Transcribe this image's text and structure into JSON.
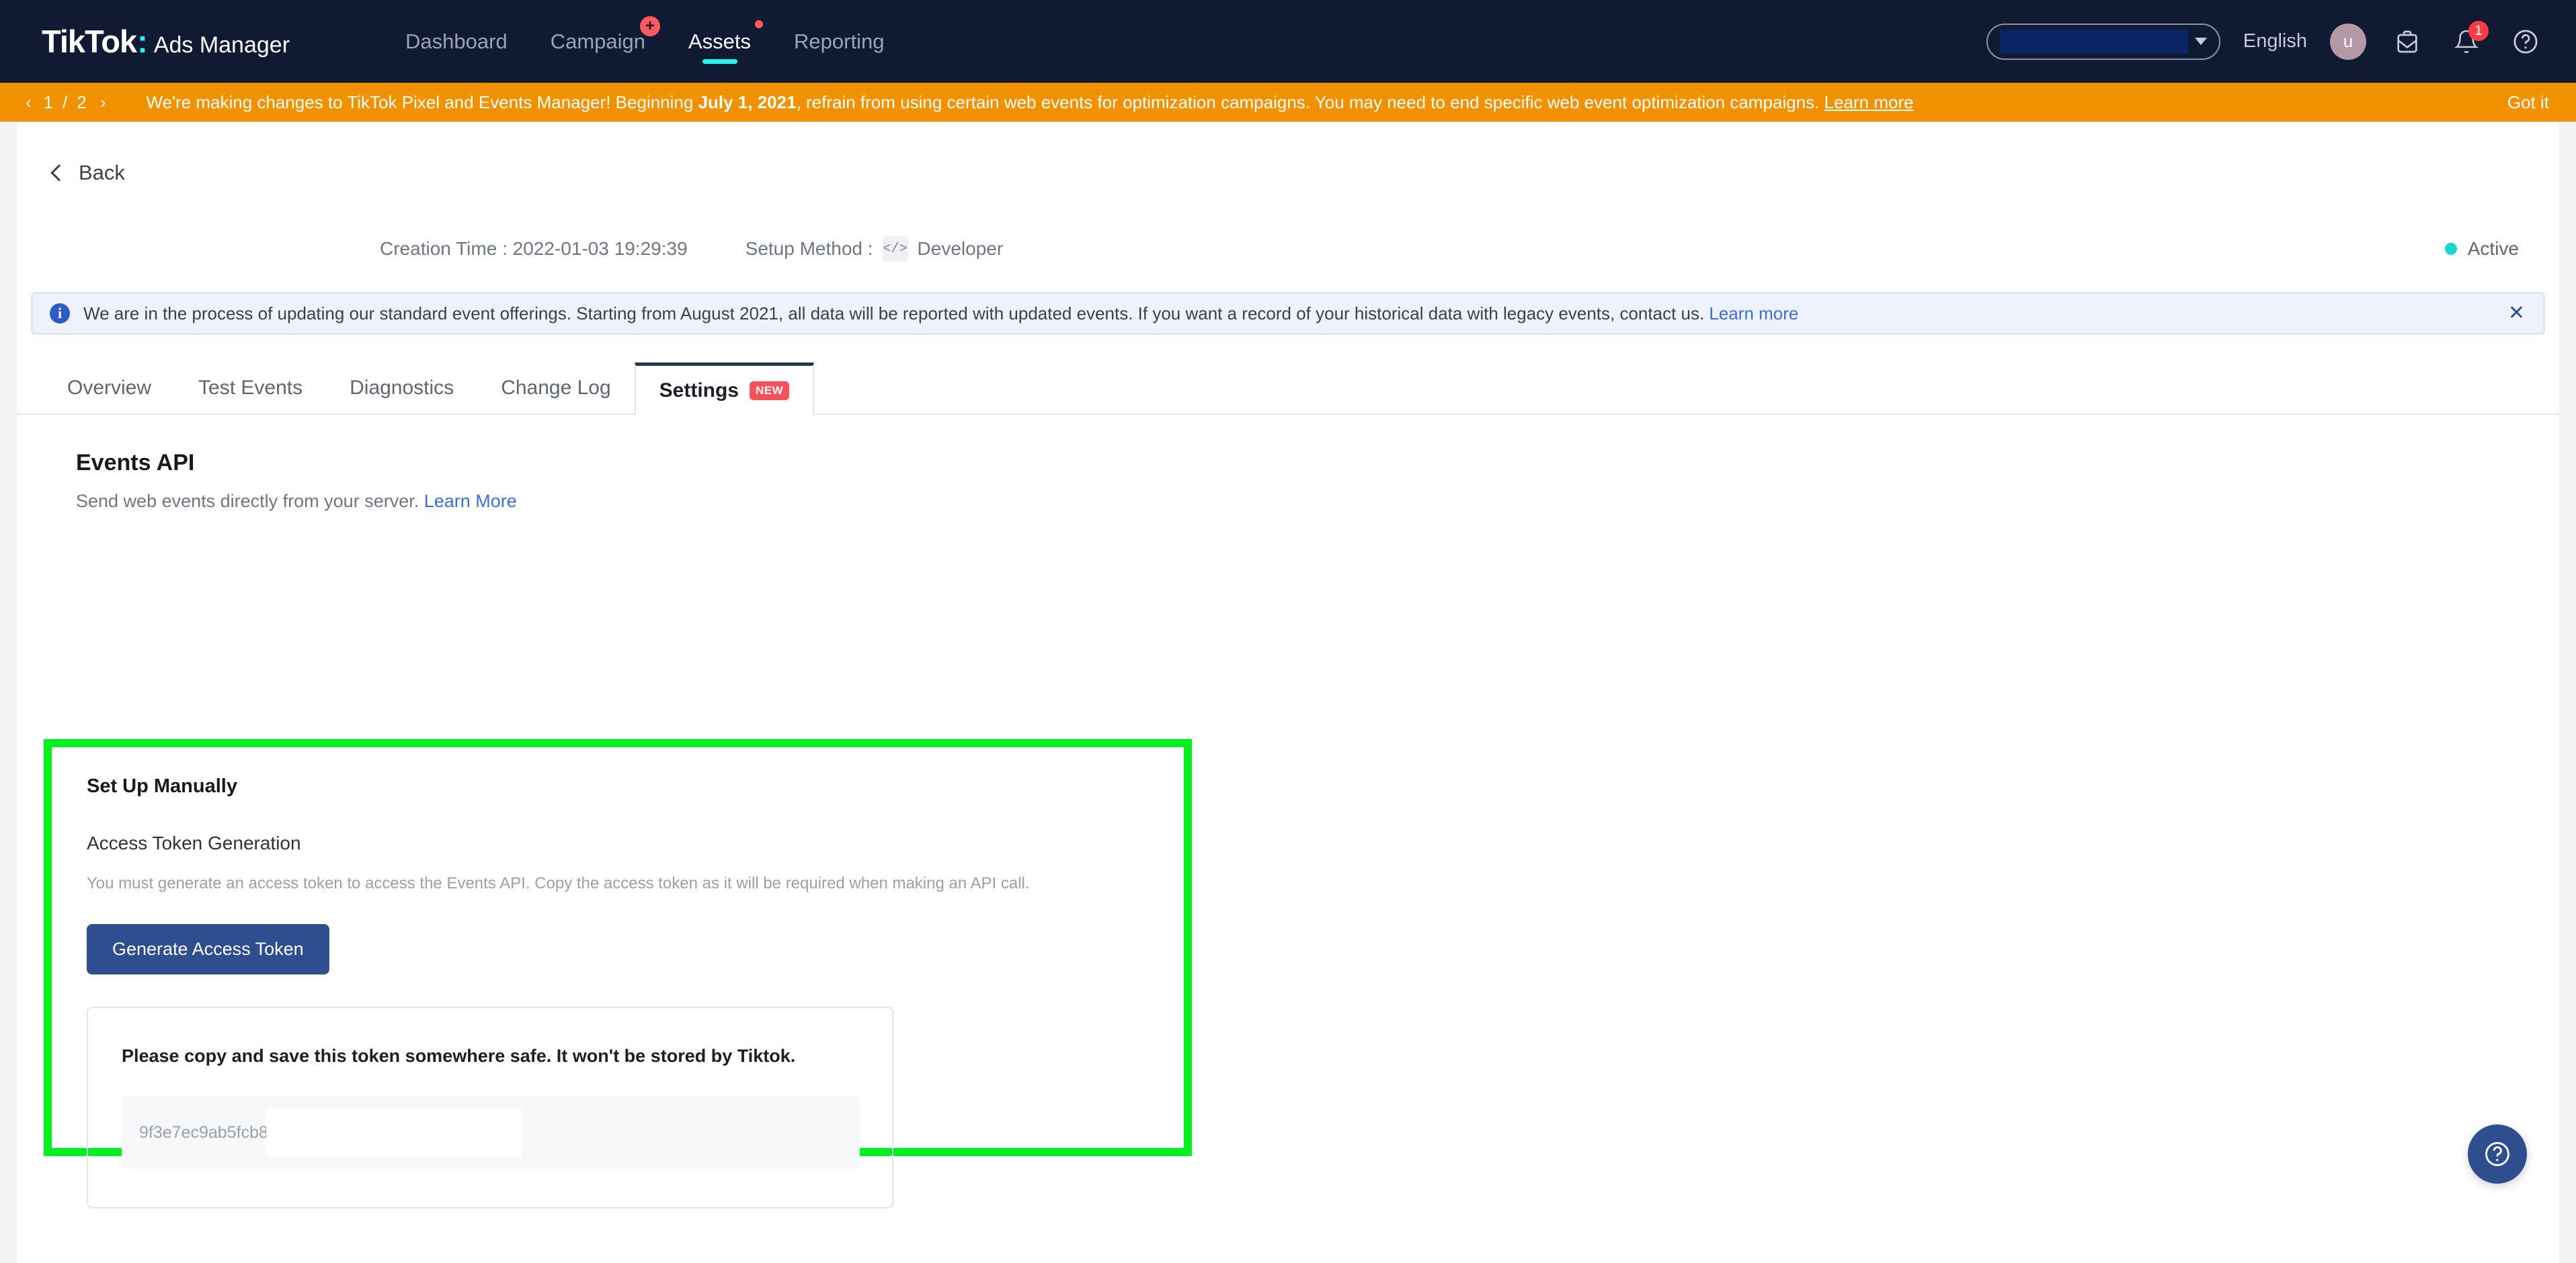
{
  "topnav": {
    "logo": "TikTok",
    "logo_colon": ":",
    "product": "Ads Manager",
    "items": [
      {
        "label": "Dashboard",
        "badge": null
      },
      {
        "label": "Campaign",
        "badge": "plus"
      },
      {
        "label": "Assets",
        "badge": "dot"
      },
      {
        "label": "Reporting",
        "badge": null
      }
    ],
    "account_selector": {
      "value": "",
      "redacted": true
    },
    "language": "English",
    "avatar_initial": "u",
    "notification_count": "1"
  },
  "orange_banner": {
    "page_current": "1",
    "page_separator": "/",
    "page_total": "2",
    "text_before": "We're making changes to TikTok Pixel and Events Manager! Beginning ",
    "text_bold": "July 1, 2021",
    "text_after": ", refrain from using certain web events for optimization campaigns. You may need to end specific web event optimization campaigns. ",
    "link": "Learn more",
    "dismiss": "Got it",
    "background": "#f29100"
  },
  "back": {
    "label": "Back"
  },
  "meta": {
    "creation_label": "Creation Time : ",
    "creation_value": "2022-01-03 19:29:39",
    "setup_label": "Setup Method : ",
    "setup_value": "Developer",
    "status": "Active",
    "status_color": "#1ad6d0"
  },
  "info_banner": {
    "text": "We are in the process of updating our standard event offerings. Starting from August 2021, all data will be reported with updated events. If you want a record of your historical data with legacy events, contact us. ",
    "link": "Learn more",
    "close": "✕"
  },
  "tabs": [
    {
      "label": "Overview",
      "active": false,
      "badge": null
    },
    {
      "label": "Test Events",
      "active": false,
      "badge": null
    },
    {
      "label": "Diagnostics",
      "active": false,
      "badge": null
    },
    {
      "label": "Change Log",
      "active": false,
      "badge": null
    },
    {
      "label": "Settings",
      "active": true,
      "badge": "NEW"
    }
  ],
  "events_api": {
    "title": "Events API",
    "subtitle": "Send web events directly from your server. ",
    "subtitle_link": "Learn More"
  },
  "setup_manually": {
    "title": "Set Up Manually",
    "access_token_title": "Access Token Generation",
    "access_token_desc": "You must generate an access token to access the Events API. Copy the access token as it will be required when making an API call.",
    "generate_button": "Generate Access Token",
    "token_note": "Please copy and save this token somewhere safe. It won't be stored by Tiktok.",
    "token_value": "9f3e7ec9ab5fcb8",
    "highlight_color": "#00f11d"
  },
  "help_fab": {
    "label": "?"
  }
}
